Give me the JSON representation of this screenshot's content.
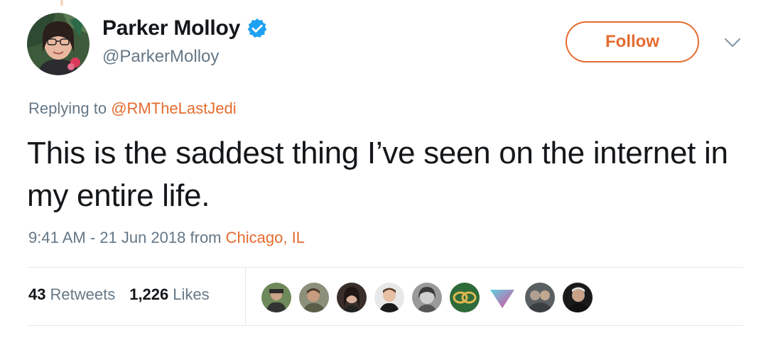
{
  "user": {
    "display_name": "Parker Molloy",
    "handle": "@ParkerMolloy",
    "verified": true
  },
  "follow_button": {
    "label": "Follow"
  },
  "reply": {
    "prefix": "Replying to",
    "mention": "@RMTheLastJedi"
  },
  "tweet": {
    "text": "This is the saddest thing I’ve seen on the internet in my entire life."
  },
  "meta": {
    "timestamp": "9:41 AM - 21 Jun 2018",
    "from_word": "from",
    "location": "Chicago, IL"
  },
  "stats": {
    "retweets_count": "43",
    "retweets_label": "Retweets",
    "likes_count": "1,226",
    "likes_label": "Likes"
  },
  "icons": {
    "verified": "verified-badge-icon",
    "more": "chevron-down-icon"
  },
  "colors": {
    "accent": "#e56b2f",
    "verified": "#1da1f2",
    "secondary_text": "#657786",
    "primary_text": "#14171a",
    "divider": "#e1e8ed"
  }
}
